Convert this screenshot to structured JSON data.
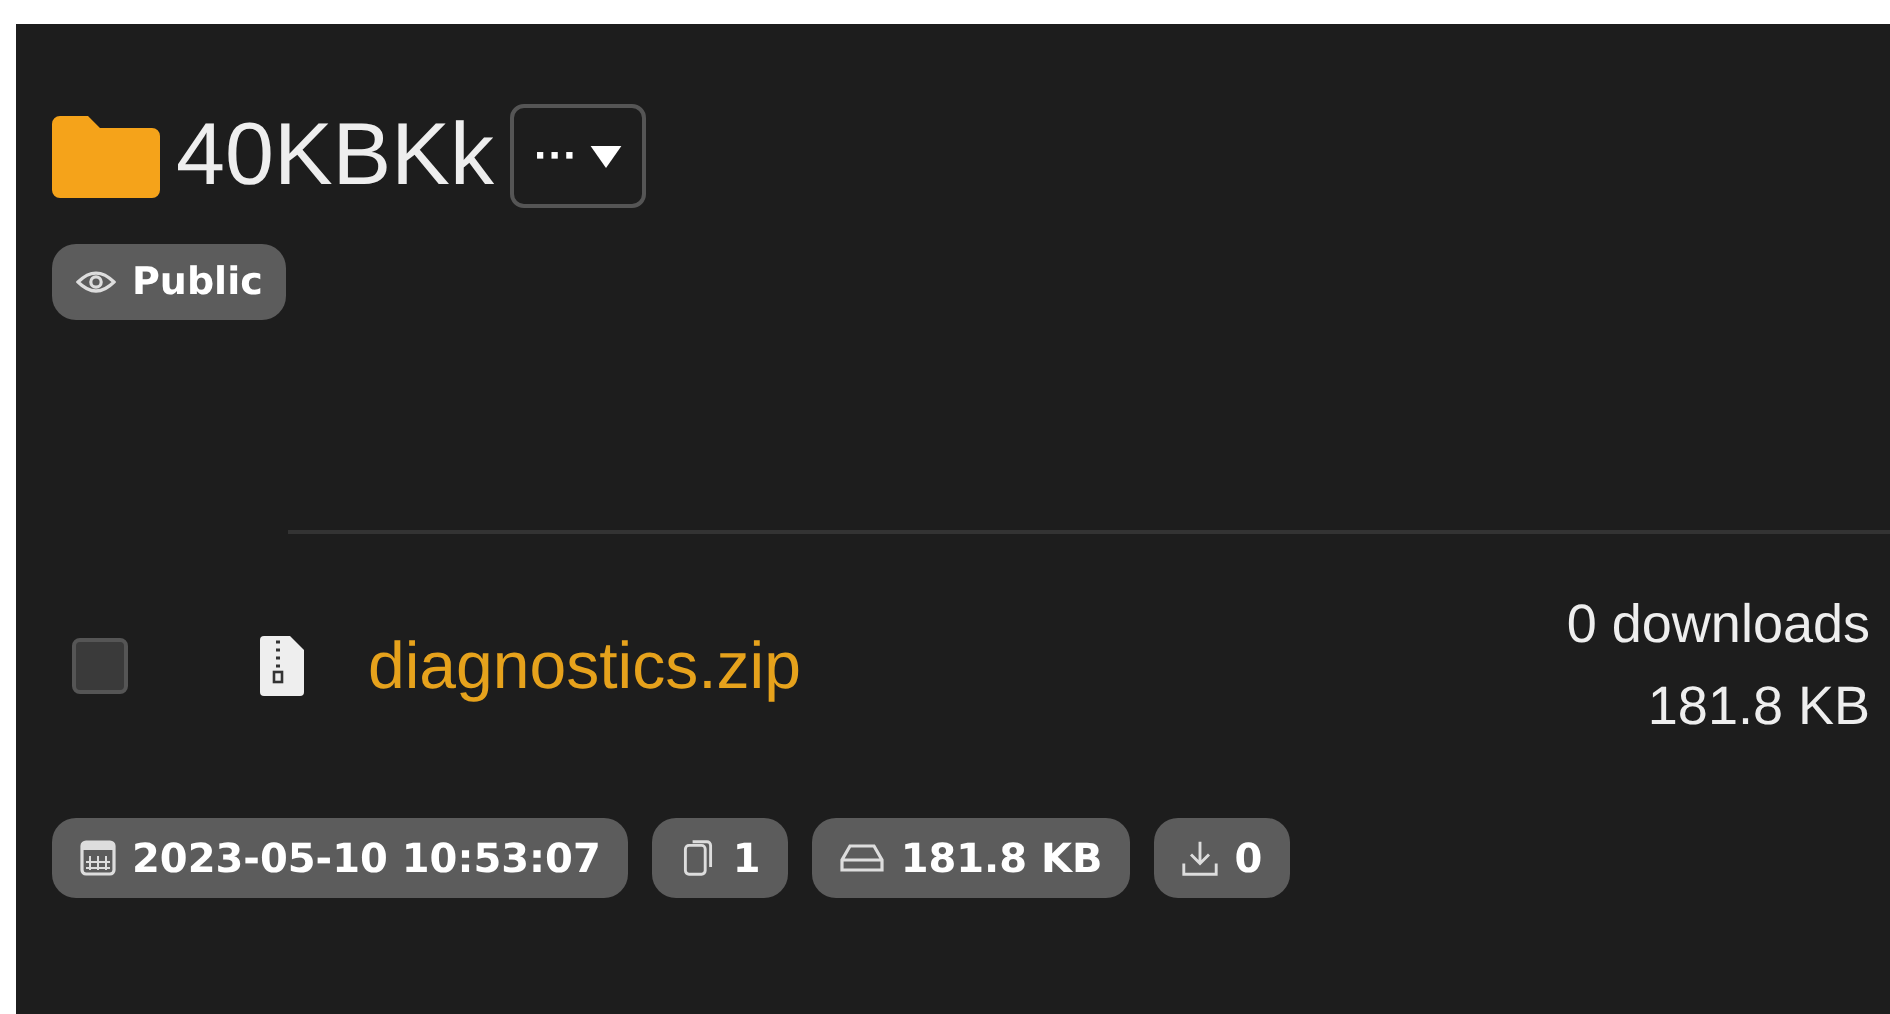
{
  "folder": {
    "name": "40KBKk",
    "menu_label": "···"
  },
  "visibility": {
    "label": "Public"
  },
  "file": {
    "name": "diagnostics.zip",
    "checked": false,
    "downloads": "0 downloads",
    "size": "181.8 KB"
  },
  "stats": [
    {
      "kind": "date",
      "text": "2023-05-10 10:53:07"
    },
    {
      "kind": "files",
      "text": "1"
    },
    {
      "kind": "size",
      "text": "181.8 KB"
    },
    {
      "kind": "downloads",
      "text": "0"
    }
  ]
}
